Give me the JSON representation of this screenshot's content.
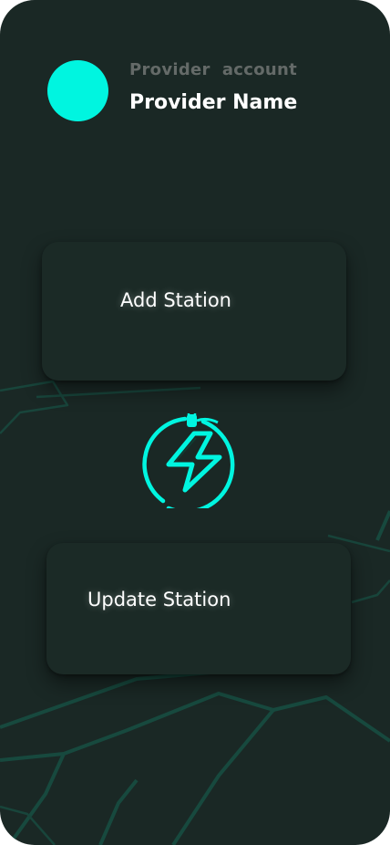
{
  "header": {
    "account_label": "Provider  account",
    "provider_name": "Provider Name"
  },
  "actions": {
    "add_station_label": "Add Station",
    "update_station_label": "Update Station"
  },
  "logo": {
    "icon": "ev-charging-bolt-icon"
  },
  "colors": {
    "background": "#1a2825",
    "accent": "#00f5e0",
    "card": "#1b2a26",
    "decor_lines": "#17493e"
  }
}
